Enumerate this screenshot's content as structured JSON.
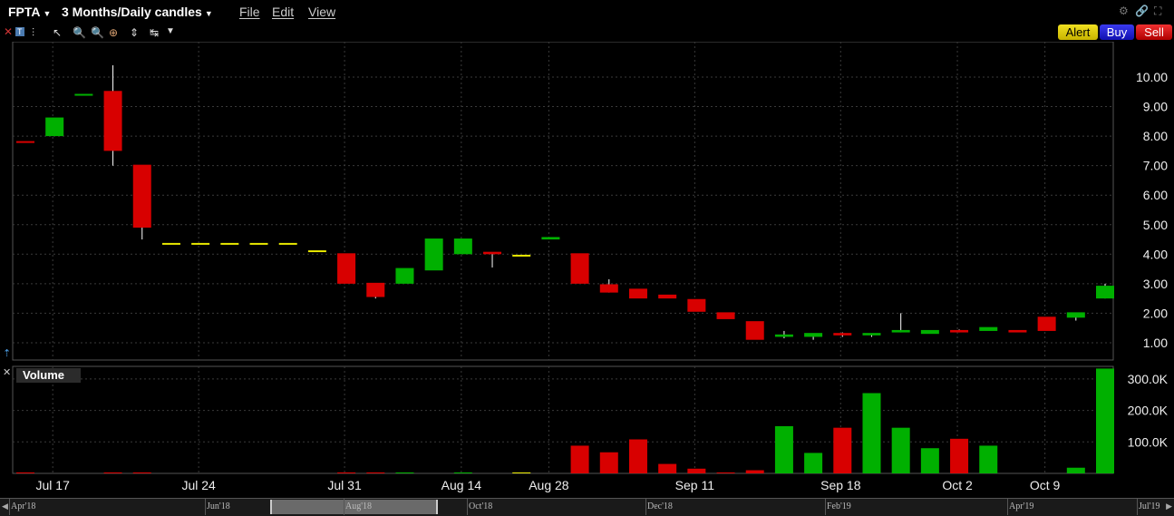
{
  "window": {
    "symbol": "FPTA",
    "period": "3 Months/Daily candles",
    "menu": [
      "File",
      "Edit",
      "View"
    ]
  },
  "toolbar": {
    "buttons": {
      "alert": "Alert",
      "buy": "Buy",
      "sell": "Sell"
    },
    "icons": [
      "close-icon",
      "info-icon",
      "bar-style-icon",
      "draw-line-icon",
      "zoom-in-icon",
      "zoom-out-icon",
      "crosshair-icon",
      "pan-icon",
      "fit-icon",
      "more-dropdown-icon"
    ]
  },
  "colors": {
    "up": "#00b000",
    "down": "#d80000",
    "neutral": "#e8e800",
    "grid": "#3a3a3a",
    "alert": "#e8d800",
    "buy": "#2020e0",
    "sell": "#e01010"
  },
  "volume_panel": {
    "label": "Volume"
  },
  "chart_data": [
    {
      "type": "candlestick",
      "symbol": "FPTA",
      "ylim": [
        0.4,
        10.9
      ],
      "yticks": [
        "1.00",
        "2.00",
        "3.00",
        "4.00",
        "5.00",
        "6.00",
        "7.00",
        "8.00",
        "9.00",
        "10.00"
      ],
      "xtick_labels": [
        "Jul 17",
        "Jul 24",
        "Jul 31",
        "Aug 14",
        "Aug 28",
        "Sep 11",
        "Sep 18",
        "Oct 2",
        "Oct 9"
      ],
      "candles": [
        {
          "o": 7.8,
          "h": 7.8,
          "l": 7.8,
          "c": 7.8
        },
        {
          "o": 8.0,
          "h": 8.6,
          "l": 8.0,
          "c": 8.6
        },
        {
          "o": 9.4,
          "h": 9.4,
          "l": 9.4,
          "c": 9.4
        },
        {
          "o": 9.5,
          "h": 10.4,
          "l": 7.0,
          "c": 7.5
        },
        {
          "o": 7.0,
          "h": 7.0,
          "l": 4.5,
          "c": 4.9
        },
        {
          "o": 4.35,
          "h": 4.35,
          "l": 4.35,
          "c": 4.35
        },
        {
          "o": 4.35,
          "h": 4.35,
          "l": 4.35,
          "c": 4.35
        },
        {
          "o": 4.35,
          "h": 4.35,
          "l": 4.35,
          "c": 4.35
        },
        {
          "o": 4.35,
          "h": 4.35,
          "l": 4.35,
          "c": 4.35
        },
        {
          "o": 4.35,
          "h": 4.35,
          "l": 4.35,
          "c": 4.35
        },
        {
          "o": 4.1,
          "h": 4.1,
          "l": 4.1,
          "c": 4.1
        },
        {
          "o": 4.0,
          "h": 4.0,
          "l": 3.0,
          "c": 3.0
        },
        {
          "o": 3.0,
          "h": 3.0,
          "l": 2.5,
          "c": 2.55
        },
        {
          "o": 3.0,
          "h": 3.5,
          "l": 3.0,
          "c": 3.5
        },
        {
          "o": 3.45,
          "h": 4.5,
          "l": 3.45,
          "c": 4.5
        },
        {
          "o": 4.0,
          "h": 4.5,
          "l": 4.0,
          "c": 4.5
        },
        {
          "o": 4.05,
          "h": 4.05,
          "l": 3.55,
          "c": 4.0
        },
        {
          "o": 3.95,
          "h": 3.95,
          "l": 3.95,
          "c": 3.95
        },
        {
          "o": 4.5,
          "h": 4.5,
          "l": 4.5,
          "c": 4.55
        },
        {
          "o": 4.0,
          "h": 4.0,
          "l": 3.0,
          "c": 3.0
        },
        {
          "o": 2.95,
          "h": 3.15,
          "l": 2.7,
          "c": 2.7
        },
        {
          "o": 2.8,
          "h": 2.8,
          "l": 2.5,
          "c": 2.5
        },
        {
          "o": 2.6,
          "h": 2.6,
          "l": 2.5,
          "c": 2.5
        },
        {
          "o": 2.45,
          "h": 2.45,
          "l": 2.05,
          "c": 2.05
        },
        {
          "o": 2.0,
          "h": 2.0,
          "l": 1.8,
          "c": 1.8
        },
        {
          "o": 1.7,
          "h": 1.7,
          "l": 1.1,
          "c": 1.1
        },
        {
          "o": 1.2,
          "h": 1.4,
          "l": 1.15,
          "c": 1.25
        },
        {
          "o": 1.2,
          "h": 1.3,
          "l": 1.1,
          "c": 1.3
        },
        {
          "o": 1.3,
          "h": 1.35,
          "l": 1.2,
          "c": 1.25
        },
        {
          "o": 1.25,
          "h": 1.3,
          "l": 1.2,
          "c": 1.3
        },
        {
          "o": 1.35,
          "h": 2.0,
          "l": 1.35,
          "c": 1.4
        },
        {
          "o": 1.3,
          "h": 1.4,
          "l": 1.3,
          "c": 1.4
        },
        {
          "o": 1.4,
          "h": 1.45,
          "l": 1.35,
          "c": 1.35
        },
        {
          "o": 1.4,
          "h": 1.5,
          "l": 1.4,
          "c": 1.5
        },
        {
          "o": 1.4,
          "h": 1.4,
          "l": 1.35,
          "c": 1.35
        },
        {
          "o": 1.85,
          "h": 1.85,
          "l": 1.4,
          "c": 1.4
        },
        {
          "o": 1.85,
          "h": 2.0,
          "l": 1.75,
          "c": 2.0
        },
        {
          "o": 2.5,
          "h": 3.0,
          "l": 2.5,
          "c": 2.9
        }
      ]
    },
    {
      "type": "bar",
      "name": "Volume",
      "ylim": [
        0,
        340000
      ],
      "yticks": [
        "100.0K",
        "200.0K",
        "300.0K"
      ],
      "values": [
        3000,
        0,
        0,
        3000,
        3000,
        0,
        0,
        0,
        0,
        0,
        0,
        3000,
        3000,
        3000,
        0,
        3000,
        0,
        3000,
        0,
        88000,
        67000,
        108000,
        30000,
        15000,
        3000,
        10000,
        150000,
        65000,
        145000,
        255000,
        145000,
        80000,
        110000,
        88000,
        0,
        0,
        18000,
        333000
      ],
      "directions": [
        "down",
        "up",
        "up",
        "down",
        "down",
        "flat",
        "flat",
        "flat",
        "flat",
        "flat",
        "flat",
        "down",
        "down",
        "up",
        "up",
        "up",
        "down",
        "flat",
        "up",
        "down",
        "down",
        "down",
        "down",
        "down",
        "down",
        "down",
        "up",
        "up",
        "down",
        "up",
        "up",
        "up",
        "down",
        "up",
        "down",
        "down",
        "up",
        "up"
      ]
    }
  ],
  "scrollbar": {
    "labels": [
      "Apr'18",
      "Jun'18",
      "Aug'18",
      "Oct'18",
      "Dec'18",
      "Feb'19",
      "Apr'19",
      "Jul'19"
    ],
    "range_start": 0.23,
    "range_end": 0.37
  }
}
